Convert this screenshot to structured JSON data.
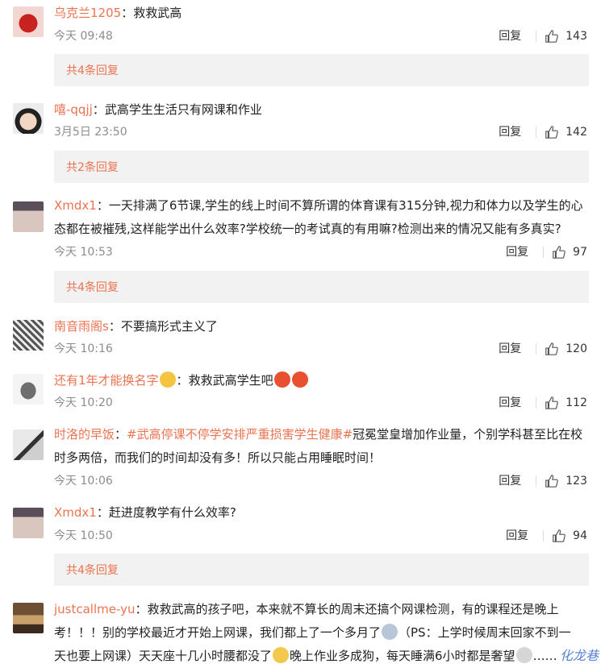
{
  "comments": [
    {
      "user": "乌克兰1205",
      "text": "救救武高",
      "time": "今天 09:48",
      "reply": "回复",
      "likes": "143",
      "more": "共4条回复"
    },
    {
      "user": "嘻-qqjj",
      "text": "武高学生生活只有网课和作业",
      "time": "3月5日 23:50",
      "reply": "回复",
      "likes": "142",
      "more": "共2条回复"
    },
    {
      "user": "Xmdx1",
      "text1": "一天排满了6节课,学生的线上时间不算所谓的体育课有315分钟,视力和体力以及学生的心",
      "text2": "态都在被摧残,这样能学出什么效率?学校统一的考试真的有用嘛?检测出来的情况又能有多真实?",
      "time": "今天 10:53",
      "reply": "回复",
      "likes": "97",
      "more": "共4条回复"
    },
    {
      "user": "南音雨阁s",
      "text": "不要搞形式主义了",
      "time": "今天 10:16",
      "reply": "回复",
      "likes": "120"
    },
    {
      "user": "还有1年才能换名字",
      "text": "救救武高学生吧",
      "time": "今天 10:20",
      "reply": "回复",
      "likes": "112"
    },
    {
      "user": "时洛的早饭",
      "tag": "#武高停课不停学安排严重损害学生健康#",
      "text1": "冠冕堂皇增加作业量，个别学科甚至比在校",
      "text2": "时多两倍，而我们的时间却没有多！所以只能占用睡眠时间！",
      "time": "今天 10:06",
      "reply": "回复",
      "likes": "123"
    },
    {
      "user": "Xmdx1",
      "text": "赶进度教学有什么效率?",
      "time": "今天 10:50",
      "reply": "回复",
      "likes": "94",
      "more": "共4条回复"
    },
    {
      "user": "justcallme-yu",
      "text1": "救救武高的孩子吧，本来就不算长的周末还搞个网课检测，有的课程还是晚上",
      "text2a": "考！！！别的学校最近才开始上网课，我们都上了一个多月了",
      "text2b": "（PS：上学时候周末回家不到一",
      "text3a": "天也要上网课）天天座十几小时腰都没了",
      "text3b": "晚上作业多成狗，每天睡满6小时都是奢望",
      "text3c": "……"
    }
  ],
  "separator": "：",
  "watermark": "化龙巷",
  "icons": {
    "like": "thumbs-up-icon"
  },
  "colors": {
    "username": "#eb7350",
    "meta": "#8c8c8c",
    "replybox": "#f2f2f2"
  }
}
